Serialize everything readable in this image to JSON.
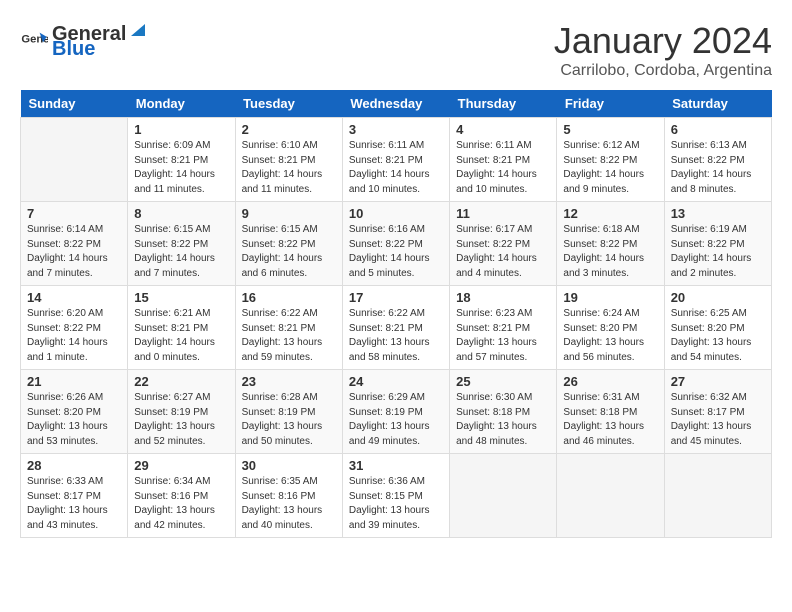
{
  "header": {
    "logo_general": "General",
    "logo_blue": "Blue",
    "month": "January 2024",
    "location": "Carrilobo, Cordoba, Argentina"
  },
  "days_of_week": [
    "Sunday",
    "Monday",
    "Tuesday",
    "Wednesday",
    "Thursday",
    "Friday",
    "Saturday"
  ],
  "weeks": [
    [
      {
        "day": "",
        "sunrise": "",
        "sunset": "",
        "daylight": ""
      },
      {
        "day": "1",
        "sunrise": "6:09 AM",
        "sunset": "8:21 PM",
        "daylight": "14 hours and 11 minutes."
      },
      {
        "day": "2",
        "sunrise": "6:10 AM",
        "sunset": "8:21 PM",
        "daylight": "14 hours and 11 minutes."
      },
      {
        "day": "3",
        "sunrise": "6:11 AM",
        "sunset": "8:21 PM",
        "daylight": "14 hours and 10 minutes."
      },
      {
        "day": "4",
        "sunrise": "6:11 AM",
        "sunset": "8:21 PM",
        "daylight": "14 hours and 10 minutes."
      },
      {
        "day": "5",
        "sunrise": "6:12 AM",
        "sunset": "8:22 PM",
        "daylight": "14 hours and 9 minutes."
      },
      {
        "day": "6",
        "sunrise": "6:13 AM",
        "sunset": "8:22 PM",
        "daylight": "14 hours and 8 minutes."
      }
    ],
    [
      {
        "day": "7",
        "sunrise": "6:14 AM",
        "sunset": "8:22 PM",
        "daylight": "14 hours and 7 minutes."
      },
      {
        "day": "8",
        "sunrise": "6:15 AM",
        "sunset": "8:22 PM",
        "daylight": "14 hours and 7 minutes."
      },
      {
        "day": "9",
        "sunrise": "6:15 AM",
        "sunset": "8:22 PM",
        "daylight": "14 hours and 6 minutes."
      },
      {
        "day": "10",
        "sunrise": "6:16 AM",
        "sunset": "8:22 PM",
        "daylight": "14 hours and 5 minutes."
      },
      {
        "day": "11",
        "sunrise": "6:17 AM",
        "sunset": "8:22 PM",
        "daylight": "14 hours and 4 minutes."
      },
      {
        "day": "12",
        "sunrise": "6:18 AM",
        "sunset": "8:22 PM",
        "daylight": "14 hours and 3 minutes."
      },
      {
        "day": "13",
        "sunrise": "6:19 AM",
        "sunset": "8:22 PM",
        "daylight": "14 hours and 2 minutes."
      }
    ],
    [
      {
        "day": "14",
        "sunrise": "6:20 AM",
        "sunset": "8:22 PM",
        "daylight": "14 hours and 1 minute."
      },
      {
        "day": "15",
        "sunrise": "6:21 AM",
        "sunset": "8:21 PM",
        "daylight": "14 hours and 0 minutes."
      },
      {
        "day": "16",
        "sunrise": "6:22 AM",
        "sunset": "8:21 PM",
        "daylight": "13 hours and 59 minutes."
      },
      {
        "day": "17",
        "sunrise": "6:22 AM",
        "sunset": "8:21 PM",
        "daylight": "13 hours and 58 minutes."
      },
      {
        "day": "18",
        "sunrise": "6:23 AM",
        "sunset": "8:21 PM",
        "daylight": "13 hours and 57 minutes."
      },
      {
        "day": "19",
        "sunrise": "6:24 AM",
        "sunset": "8:20 PM",
        "daylight": "13 hours and 56 minutes."
      },
      {
        "day": "20",
        "sunrise": "6:25 AM",
        "sunset": "8:20 PM",
        "daylight": "13 hours and 54 minutes."
      }
    ],
    [
      {
        "day": "21",
        "sunrise": "6:26 AM",
        "sunset": "8:20 PM",
        "daylight": "13 hours and 53 minutes."
      },
      {
        "day": "22",
        "sunrise": "6:27 AM",
        "sunset": "8:19 PM",
        "daylight": "13 hours and 52 minutes."
      },
      {
        "day": "23",
        "sunrise": "6:28 AM",
        "sunset": "8:19 PM",
        "daylight": "13 hours and 50 minutes."
      },
      {
        "day": "24",
        "sunrise": "6:29 AM",
        "sunset": "8:19 PM",
        "daylight": "13 hours and 49 minutes."
      },
      {
        "day": "25",
        "sunrise": "6:30 AM",
        "sunset": "8:18 PM",
        "daylight": "13 hours and 48 minutes."
      },
      {
        "day": "26",
        "sunrise": "6:31 AM",
        "sunset": "8:18 PM",
        "daylight": "13 hours and 46 minutes."
      },
      {
        "day": "27",
        "sunrise": "6:32 AM",
        "sunset": "8:17 PM",
        "daylight": "13 hours and 45 minutes."
      }
    ],
    [
      {
        "day": "28",
        "sunrise": "6:33 AM",
        "sunset": "8:17 PM",
        "daylight": "13 hours and 43 minutes."
      },
      {
        "day": "29",
        "sunrise": "6:34 AM",
        "sunset": "8:16 PM",
        "daylight": "13 hours and 42 minutes."
      },
      {
        "day": "30",
        "sunrise": "6:35 AM",
        "sunset": "8:16 PM",
        "daylight": "13 hours and 40 minutes."
      },
      {
        "day": "31",
        "sunrise": "6:36 AM",
        "sunset": "8:15 PM",
        "daylight": "13 hours and 39 minutes."
      },
      {
        "day": "",
        "sunrise": "",
        "sunset": "",
        "daylight": ""
      },
      {
        "day": "",
        "sunrise": "",
        "sunset": "",
        "daylight": ""
      },
      {
        "day": "",
        "sunrise": "",
        "sunset": "",
        "daylight": ""
      }
    ]
  ]
}
